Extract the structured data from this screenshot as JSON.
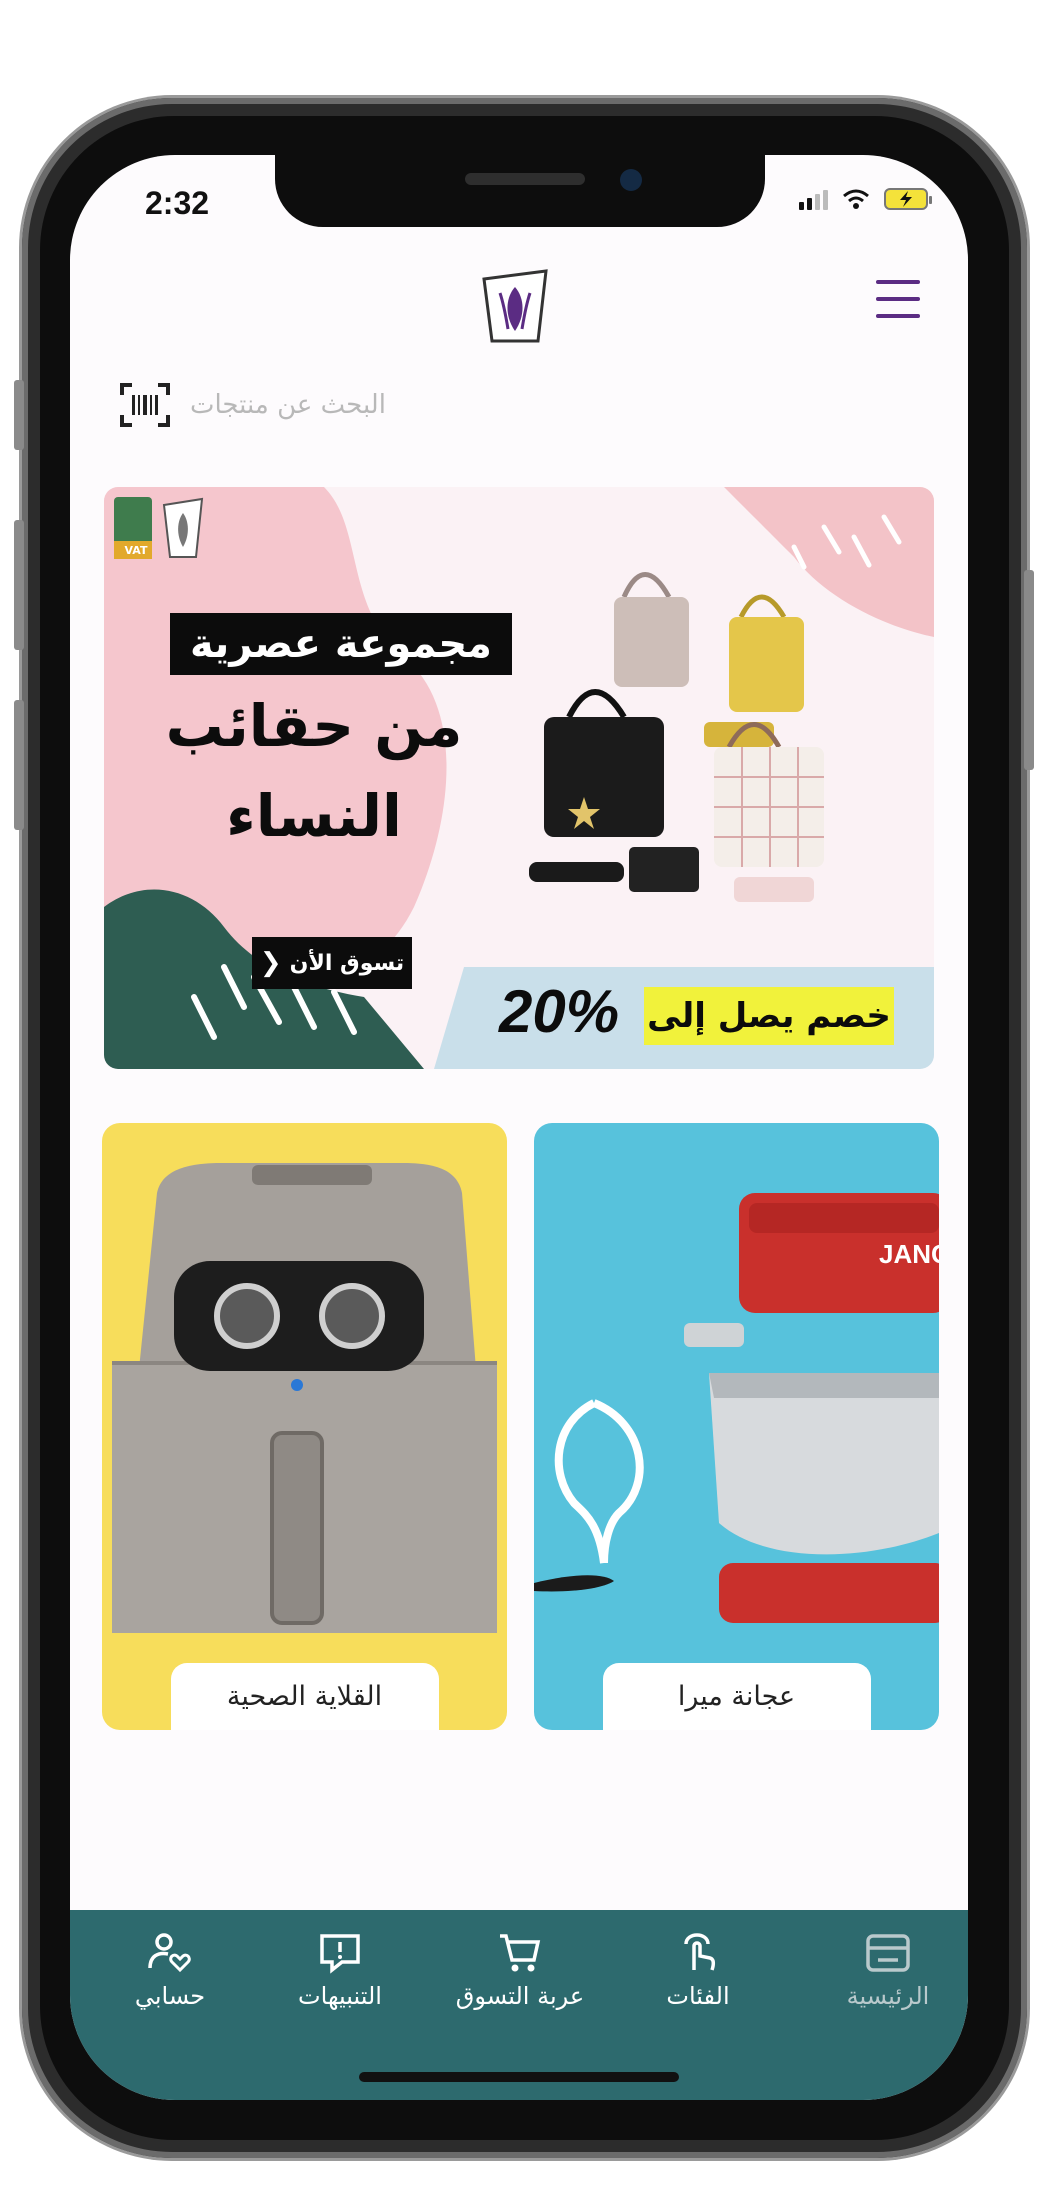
{
  "status_bar": {
    "time": "2:32"
  },
  "search": {
    "placeholder": "البحث عن منتجات"
  },
  "banner": {
    "headline_1": "مجموعة عصرية",
    "headline_2": "من حقائب",
    "headline_3": "النساء",
    "cta_label": "تسوق الأن",
    "discount_text": "خصم يصل إلى",
    "discount_value": "20%",
    "badge_text": "VAT"
  },
  "products": [
    {
      "label": "عجانة ميرا"
    },
    {
      "label": "القلاية الصحية"
    }
  ],
  "nav": {
    "home": "الرئيسية",
    "categories": "الفئات",
    "cart": "عربة التسوق",
    "notifications": "التنبيهات",
    "account": "حسابي"
  },
  "colors": {
    "brand": "#5b2c83",
    "nav_background": "#2d6a6e",
    "banner_highlight": "#f1f23b"
  }
}
